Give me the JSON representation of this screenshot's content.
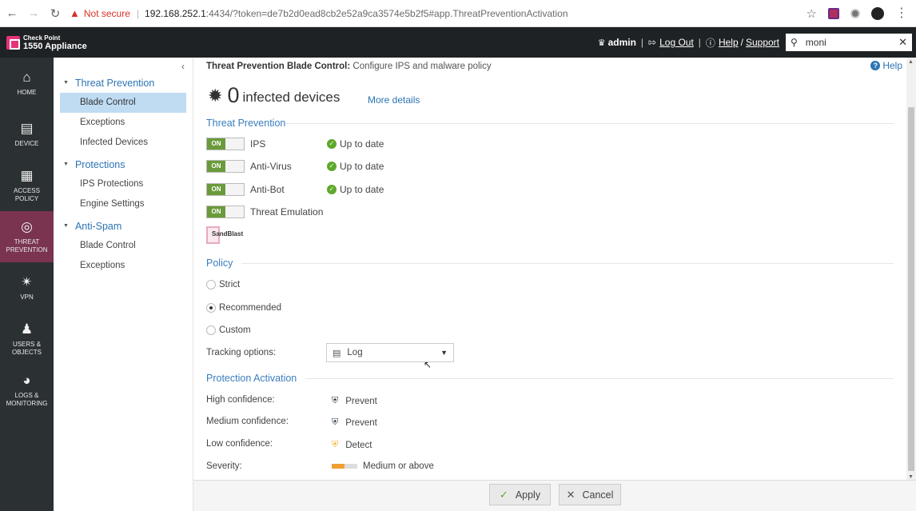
{
  "browser": {
    "not_secure": "Not secure",
    "url_host": "192.168.252.1",
    "url_rest": ":4434/?token=de7b2d0ead8cb2e52a9ca3574e5b2f5#app.ThreatPreventionActivation"
  },
  "header": {
    "brand_small": "Check Point",
    "brand_big": "1550 Appliance",
    "user": "admin",
    "logout": "Log Out",
    "help": "Help",
    "support": "Support",
    "search_value": "moni"
  },
  "rail": [
    {
      "label": "HOME",
      "icon": "home-icon"
    },
    {
      "label": "DEVICE",
      "icon": "device-icon"
    },
    {
      "label": "ACCESS POLICY",
      "icon": "grid-icon"
    },
    {
      "label": "THREAT PREVENTION",
      "icon": "shield-icon"
    },
    {
      "label": "VPN",
      "icon": "vpn-icon"
    },
    {
      "label": "USERS & OBJECTS",
      "icon": "users-icon"
    },
    {
      "label": "LOGS & MONITORING",
      "icon": "gauge-icon"
    }
  ],
  "subnav": {
    "threat_prevention": "Threat Prevention",
    "blade_control": "Blade Control",
    "exceptions": "Exceptions",
    "infected_devices": "Infected Devices",
    "protections": "Protections",
    "ips_protections": "IPS Protections",
    "engine_settings": "Engine Settings",
    "anti_spam": "Anti-Spam",
    "as_blade_control": "Blade Control",
    "as_exceptions": "Exceptions"
  },
  "main": {
    "breadcrumb_bold": "Threat Prevention Blade Control:",
    "breadcrumb_rest": " Configure IPS and malware policy",
    "help": "Help",
    "infected_count": "0",
    "infected_label": "infected devices",
    "more_details": "More details",
    "section_threat_prevention": "Threat Prevention",
    "blades": [
      {
        "toggle": "ON",
        "name": "IPS",
        "status": "Up to date"
      },
      {
        "toggle": "ON",
        "name": "Anti-Virus",
        "status": "Up to date"
      },
      {
        "toggle": "ON",
        "name": "Anti-Bot",
        "status": "Up to date"
      },
      {
        "toggle": "ON",
        "name": "Threat Emulation",
        "status": ""
      }
    ],
    "sandblast": "SandBlast",
    "section_policy": "Policy",
    "policy_options": [
      "Strict",
      "Recommended",
      "Custom"
    ],
    "policy_selected": "Recommended",
    "tracking_label": "Tracking options:",
    "tracking_value": "Log",
    "section_activation": "Protection Activation",
    "activation": [
      {
        "label": "High confidence:",
        "value": "Prevent"
      },
      {
        "label": "Medium confidence:",
        "value": "Prevent"
      },
      {
        "label": "Low confidence:",
        "value": "Detect"
      },
      {
        "label": "Severity:",
        "value": "Medium or above"
      }
    ],
    "severity_level": 0.5
  },
  "footer": {
    "apply": "Apply",
    "cancel": "Cancel"
  },
  "colors": {
    "accent_blue": "#2c74b3",
    "toggle_on": "#6a9a3a",
    "rail_active": "#7a3450",
    "check_green": "#5ea92d"
  }
}
